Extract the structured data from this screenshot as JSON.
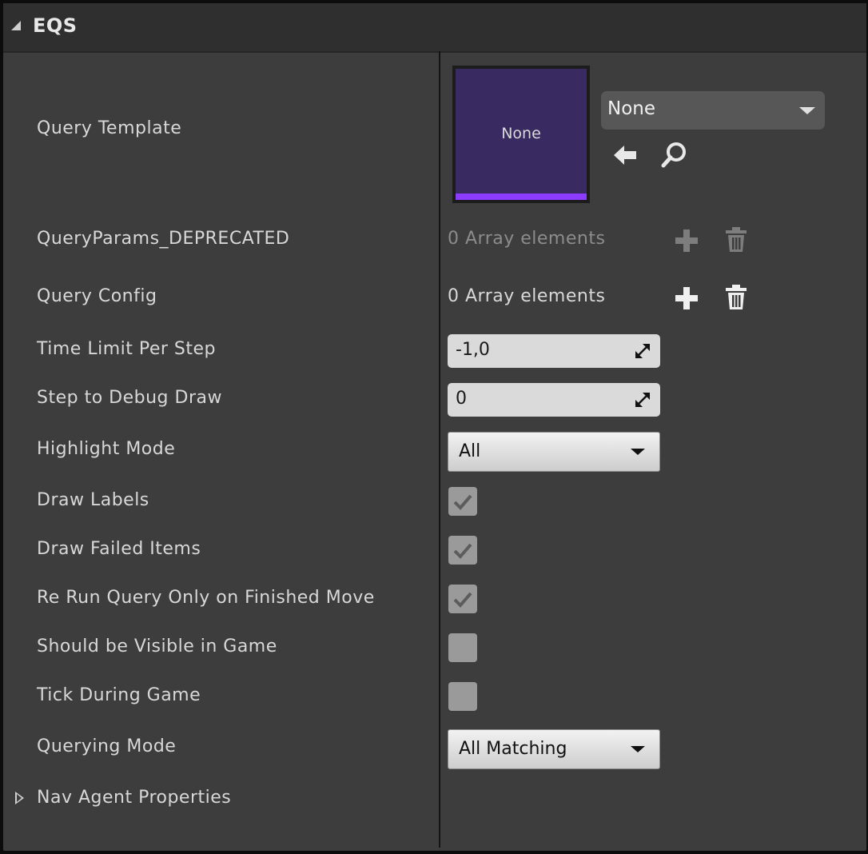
{
  "category": {
    "title": "EQS"
  },
  "query_template": {
    "label": "Query Template",
    "thumbnail_text": "None",
    "asset_value": "None",
    "thumbnail_color": "#3a2a62",
    "thumbnail_accent": "#8b3cff",
    "icons": [
      "use-selected-arrow-icon",
      "browse-search-icon"
    ]
  },
  "query_params": {
    "label": "QueryParams_DEPRECATED",
    "array_text": "0 Array elements",
    "enabled": false
  },
  "query_config": {
    "label": "Query Config",
    "array_text": "0 Array elements",
    "enabled": true
  },
  "time_limit": {
    "label": "Time Limit Per Step",
    "value": "-1,0"
  },
  "step_debug": {
    "label": "Step to Debug Draw",
    "value": "0"
  },
  "highlight_mode": {
    "label": "Highlight Mode",
    "value": "All"
  },
  "draw_labels": {
    "label": "Draw Labels",
    "checked": true
  },
  "draw_failed": {
    "label": "Draw Failed Items",
    "checked": true
  },
  "rerun_query": {
    "label": "Re Run Query Only on Finished Move",
    "checked": true
  },
  "visible_in_game": {
    "label": "Should be Visible in Game",
    "checked": false
  },
  "tick_during_game": {
    "label": "Tick During Game",
    "checked": false
  },
  "querying_mode": {
    "label": "Querying Mode",
    "value": "All Matching"
  },
  "nav_agent": {
    "label": "Nav Agent Properties",
    "expanded": false
  }
}
